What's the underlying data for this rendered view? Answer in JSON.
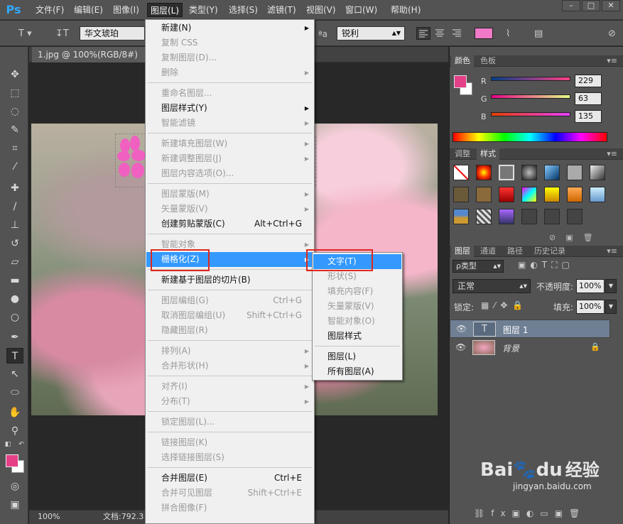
{
  "app": {
    "logo": "Ps"
  },
  "menubar": {
    "items": [
      "文件(F)",
      "编辑(E)",
      "图像(I)",
      "图层(L)",
      "类型(Y)",
      "选择(S)",
      "滤镜(T)",
      "视图(V)",
      "窗口(W)",
      "帮助(H)"
    ],
    "active": "图层(L)"
  },
  "options": {
    "font_name": "华文琥珀",
    "antialias": "锐利",
    "aa_label": "ªa",
    "text_color": "#f07ac8"
  },
  "document": {
    "tab_title": "1.jpg @ 100%(RGB/8#)",
    "zoom": "100%",
    "doc_info": "文档:792.3"
  },
  "layer_menu": {
    "items": [
      {
        "label": "新建(N)",
        "shortcut": "",
        "arrow": true,
        "disabled": false
      },
      {
        "label": "复制 CSS",
        "shortcut": "",
        "arrow": false,
        "disabled": true
      },
      {
        "label": "复制图层(D)...",
        "shortcut": "",
        "arrow": false,
        "disabled": true
      },
      {
        "label": "删除",
        "shortcut": "",
        "arrow": true,
        "disabled": true
      },
      {
        "sep": true
      },
      {
        "label": "重命名图层...",
        "shortcut": "",
        "arrow": false,
        "disabled": true
      },
      {
        "label": "图层样式(Y)",
        "shortcut": "",
        "arrow": true,
        "disabled": false
      },
      {
        "label": "智能滤镜",
        "shortcut": "",
        "arrow": true,
        "disabled": true
      },
      {
        "sep": true
      },
      {
        "label": "新建填充图层(W)",
        "shortcut": "",
        "arrow": true,
        "disabled": true
      },
      {
        "label": "新建调整图层(J)",
        "shortcut": "",
        "arrow": true,
        "disabled": true
      },
      {
        "label": "图层内容选项(O)...",
        "shortcut": "",
        "arrow": false,
        "disabled": true
      },
      {
        "sep": true
      },
      {
        "label": "图层蒙版(M)",
        "shortcut": "",
        "arrow": true,
        "disabled": true
      },
      {
        "label": "矢量蒙版(V)",
        "shortcut": "",
        "arrow": true,
        "disabled": true
      },
      {
        "label": "创建剪贴蒙版(C)",
        "shortcut": "Alt+Ctrl+G",
        "arrow": false,
        "disabled": false
      },
      {
        "sep": true
      },
      {
        "label": "智能对象",
        "shortcut": "",
        "arrow": true,
        "disabled": true
      },
      {
        "label": "栅格化(Z)",
        "shortcut": "",
        "arrow": true,
        "disabled": false,
        "highlight": true
      },
      {
        "sep": true
      },
      {
        "label": "新建基于图层的切片(B)",
        "shortcut": "",
        "arrow": false,
        "disabled": false
      },
      {
        "sep": true
      },
      {
        "label": "图层编组(G)",
        "shortcut": "Ctrl+G",
        "arrow": false,
        "disabled": true
      },
      {
        "label": "取消图层编组(U)",
        "shortcut": "Shift+Ctrl+G",
        "arrow": false,
        "disabled": true
      },
      {
        "label": "隐藏图层(R)",
        "shortcut": "",
        "arrow": false,
        "disabled": true
      },
      {
        "sep": true
      },
      {
        "label": "排列(A)",
        "shortcut": "",
        "arrow": true,
        "disabled": true
      },
      {
        "label": "合并形状(H)",
        "shortcut": "",
        "arrow": true,
        "disabled": true
      },
      {
        "sep": true
      },
      {
        "label": "对齐(I)",
        "shortcut": "",
        "arrow": true,
        "disabled": true
      },
      {
        "label": "分布(T)",
        "shortcut": "",
        "arrow": true,
        "disabled": true
      },
      {
        "sep": true
      },
      {
        "label": "锁定图层(L)...",
        "shortcut": "",
        "arrow": false,
        "disabled": true
      },
      {
        "sep": true
      },
      {
        "label": "链接图层(K)",
        "shortcut": "",
        "arrow": false,
        "disabled": true
      },
      {
        "label": "选择链接图层(S)",
        "shortcut": "",
        "arrow": false,
        "disabled": true
      },
      {
        "sep": true
      },
      {
        "label": "合并图层(E)",
        "shortcut": "Ctrl+E",
        "arrow": false,
        "disabled": false
      },
      {
        "label": "合并可见图层",
        "shortcut": "Shift+Ctrl+E",
        "arrow": false,
        "disabled": true
      },
      {
        "label": "拼合图像(F)",
        "shortcut": "",
        "arrow": false,
        "disabled": true
      }
    ]
  },
  "rasterize_submenu": {
    "items": [
      {
        "label": "文字(T)",
        "disabled": false,
        "highlight": true
      },
      {
        "label": "形状(S)",
        "disabled": true
      },
      {
        "label": "填充内容(F)",
        "disabled": true
      },
      {
        "label": "矢量蒙版(V)",
        "disabled": true
      },
      {
        "label": "智能对象(O)",
        "disabled": true
      },
      {
        "label": "图层样式",
        "disabled": false
      },
      {
        "sep": true
      },
      {
        "label": "图层(L)",
        "disabled": false
      },
      {
        "label": "所有图层(A)",
        "disabled": false
      }
    ]
  },
  "color_panel": {
    "tabs": [
      "颜色",
      "色板"
    ],
    "channels": [
      {
        "label": "R",
        "value": "229"
      },
      {
        "label": "G",
        "value": "63"
      },
      {
        "label": "B",
        "value": "135"
      }
    ],
    "fg_color": "#e53f87"
  },
  "styles_panel": {
    "tabs": [
      "调整",
      "样式"
    ]
  },
  "layers_panel": {
    "tabs": [
      "图层",
      "通道",
      "路径",
      "历史记录"
    ],
    "filter": "ρ类型",
    "blend_mode": "正常",
    "opacity_label": "不透明度:",
    "opacity": "100%",
    "lock_label": "锁定:",
    "fill_label": "填充:",
    "fill": "100%",
    "layers": [
      {
        "name": "图层 1",
        "type": "T",
        "selected": true
      },
      {
        "name": "背景",
        "type": "image",
        "locked": true
      }
    ]
  },
  "watermark": {
    "brand": "Bai",
    "brand2": "du",
    "suffix": "经验",
    "url": "jingyan.baidu.com"
  }
}
